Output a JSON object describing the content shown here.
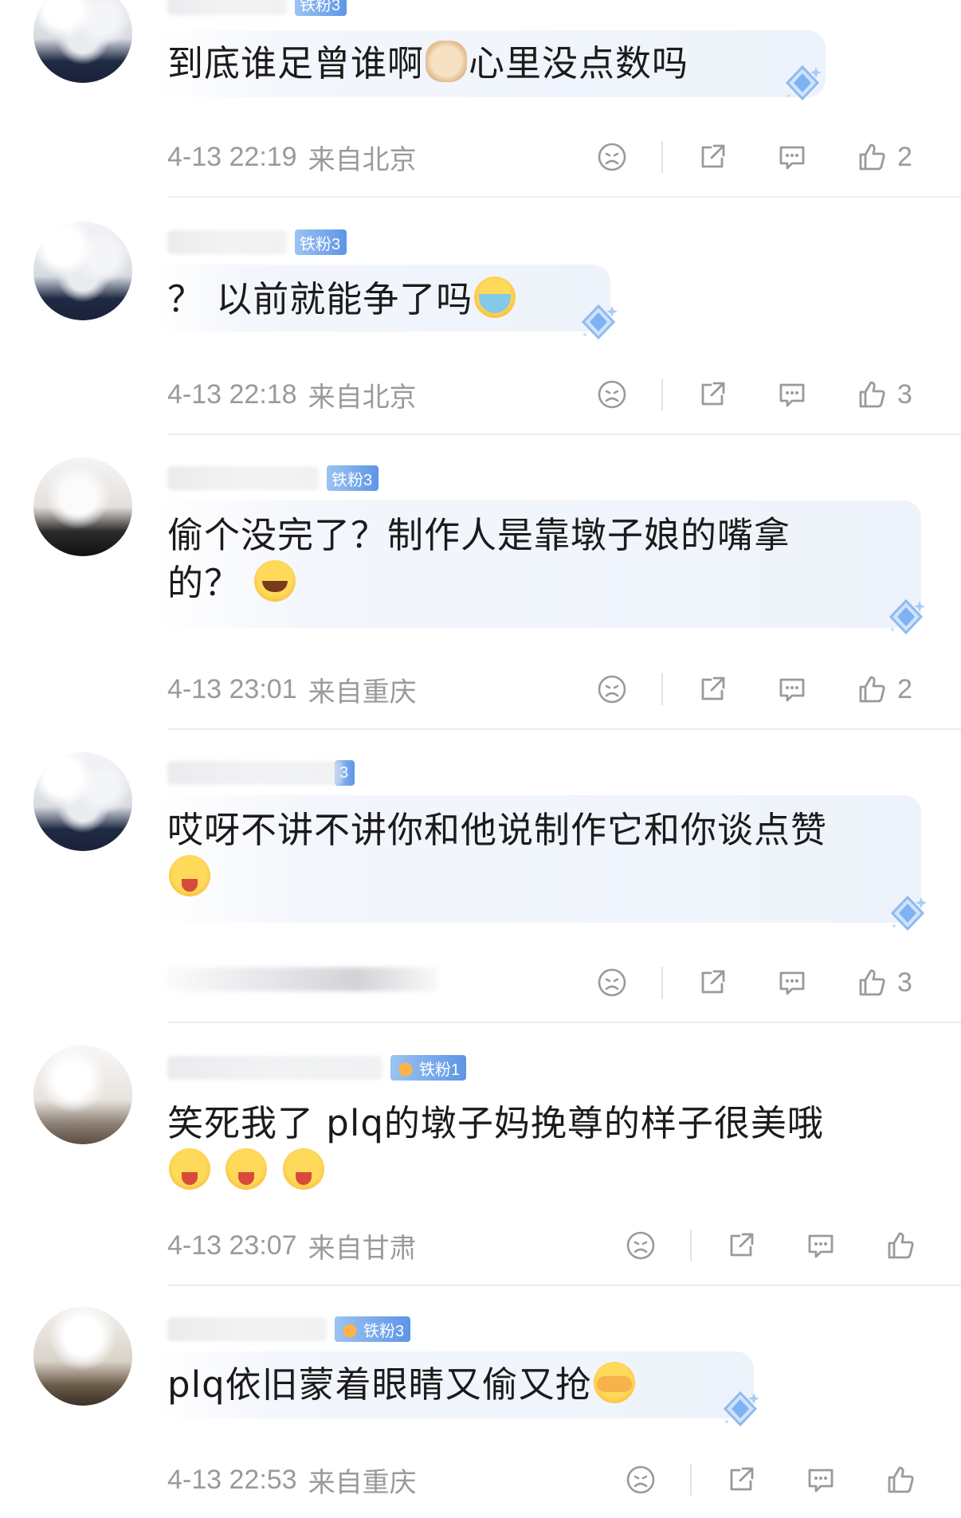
{
  "comments": [
    {
      "badge": "铁粉3",
      "text_before": "到底谁足曾谁啊",
      "text_after": "心里没点数吗",
      "emoji": "cat-emoji",
      "time": "4-13 22:19",
      "location": "来自北京",
      "likes": "2"
    },
    {
      "badge": "铁粉3",
      "text_before": "？ 以前就能争了吗",
      "text_after": "",
      "emoji": "crying-emoji",
      "time": "4-13 22:18",
      "location": "来自北京",
      "likes": "3"
    },
    {
      "badge": "铁粉3",
      "text_before": "偷个没完了？制作人是靠墩子娘的嘴拿",
      "text_line2": "的？",
      "emoji": "laughing-emoji",
      "time": "4-13 23:01",
      "location": "来自重庆",
      "likes": "2"
    },
    {
      "badge": "3",
      "text_before": "哎呀不讲不讲你和他说制作它和你谈点赞",
      "emoji": "tongue-emoji",
      "likes": "3"
    },
    {
      "badge": "铁粉1",
      "text_before": "笑死我了 plq的墩子妈挽尊的样子很美哦",
      "emoji": "tongue-emoji",
      "time": "4-13 23:07",
      "location": "来自甘肃",
      "likes": ""
    },
    {
      "badge": "铁粉3",
      "text_before": "plq依旧蒙着眼睛又偷又抢",
      "emoji": "cover-eyes-emoji",
      "time": "4-13 22:53",
      "location": "来自重庆",
      "likes": ""
    }
  ],
  "icons": {
    "dislike": "sad-face-icon",
    "share": "share-icon",
    "reply": "comment-icon",
    "like": "thumbs-up-icon"
  },
  "colors": {
    "badge": "#5d95e6",
    "meta_text": "#9a9a9a",
    "bubble": "#eef3fb"
  }
}
